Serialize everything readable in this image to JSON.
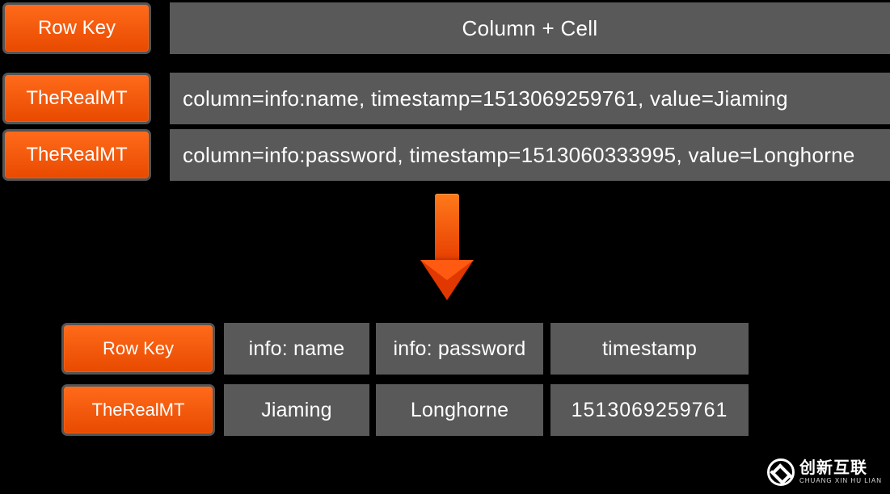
{
  "top": {
    "header": {
      "rowkey": "Row Key",
      "right": "Column + Cell"
    },
    "rows": [
      {
        "key": "TheRealMT",
        "text": "column=info:name, timestamp=1513069259761, value=Jiaming"
      },
      {
        "key": "TheRealMT",
        "text": "column=info:password, timestamp=1513060333995, value=Longhorne"
      }
    ]
  },
  "bottom": {
    "header": {
      "rowkey": "Row Key",
      "c1": "info: name",
      "c2": "info: password",
      "c3": "timestamp"
    },
    "data": {
      "rowkey": "TheRealMT",
      "c1": "Jiaming",
      "c2": "Longhorne",
      "c3": "1513069259761"
    }
  },
  "logo": {
    "cn": "创新互联",
    "en": "CHUANG XIN HU LIAN"
  }
}
